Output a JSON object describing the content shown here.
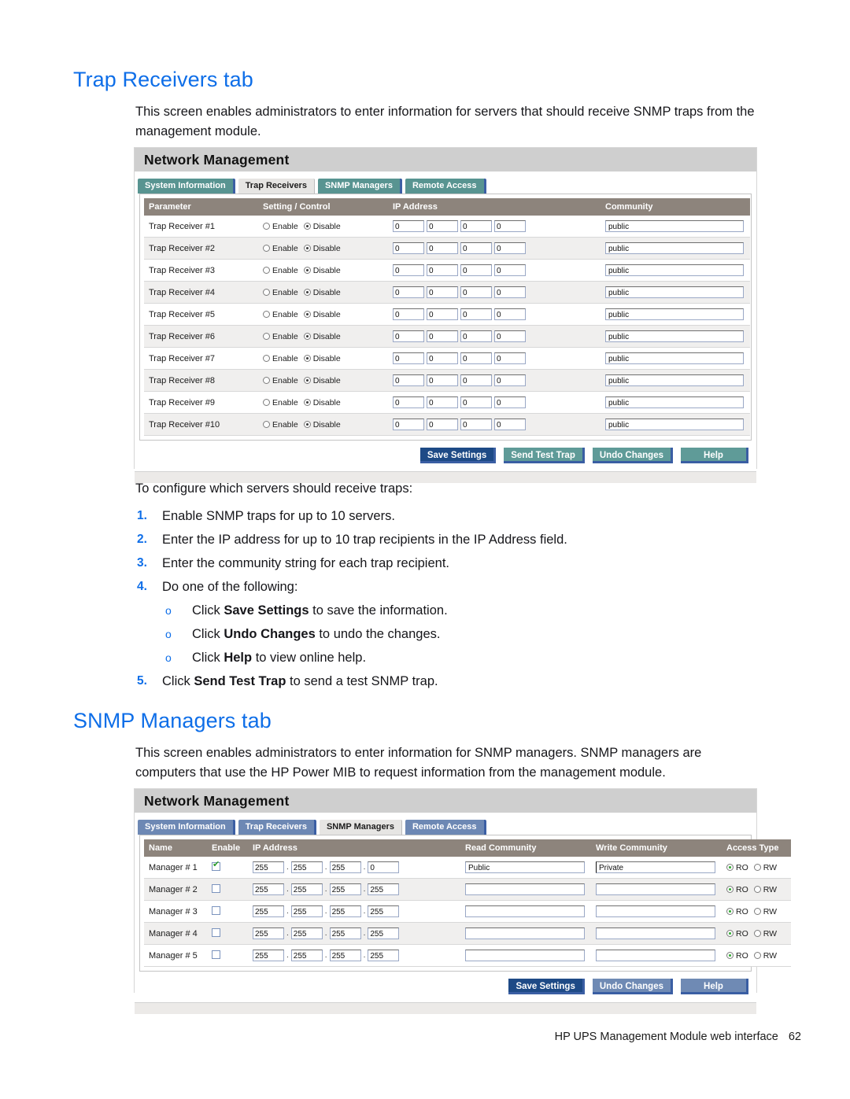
{
  "document": {
    "footer_text": "HP UPS Management Module web interface",
    "page_number": "62"
  },
  "section_trap": {
    "heading": "Trap Receivers tab",
    "intro": "This screen enables administrators to enter information for servers that should receive SNMP traps from the management module.",
    "lead_in": "To configure which servers should receive traps:",
    "steps": [
      {
        "num": "1.",
        "text": "Enable SNMP traps for up to 10 servers."
      },
      {
        "num": "2.",
        "text": "Enter the IP address for up to 10 trap recipients in the IP Address field."
      },
      {
        "num": "3.",
        "text": "Enter the community string for each trap recipient."
      },
      {
        "num": "4.",
        "text": "Do one of the following:"
      },
      {
        "num": "5.",
        "text": "Click Send Test Trap to send a test SNMP trap."
      }
    ],
    "substeps": [
      {
        "bullet": "o",
        "prefix": "Click ",
        "bold": "Save Settings",
        "suffix": " to save the information."
      },
      {
        "bullet": "o",
        "prefix": "Click ",
        "bold": "Undo Changes",
        "suffix": " to undo the changes."
      },
      {
        "bullet": "o",
        "prefix": "Click ",
        "bold": "Help",
        "suffix": " to view online help."
      }
    ],
    "step5": {
      "num": "5.",
      "prefix": "Click ",
      "bold": "Send Test Trap",
      "suffix": " to send a test SNMP trap."
    }
  },
  "section_snmp": {
    "heading": "SNMP Managers tab",
    "intro": "This screen enables administrators to enter information for SNMP managers. SNMP managers are computers that use the HP Power MIB to request information from the management module."
  },
  "shot_trap": {
    "app_title": "Network Management",
    "tabs": [
      {
        "label": "System Information",
        "active": false,
        "style": "teal"
      },
      {
        "label": "Trap Receivers",
        "active": true,
        "style": "active"
      },
      {
        "label": "SNMP Managers",
        "active": false,
        "style": "teal"
      },
      {
        "label": "Remote Access",
        "active": false,
        "style": "teal"
      }
    ],
    "columns": [
      "Parameter",
      "Setting / Control",
      "IP Address",
      "Community"
    ],
    "radio_enable_label": "Enable",
    "radio_disable_label": "Disable",
    "rows": [
      {
        "parameter": "Trap Receiver #1",
        "setting": "Disable",
        "ip": [
          "0",
          "0",
          "0",
          "0"
        ],
        "community": "public"
      },
      {
        "parameter": "Trap Receiver #2",
        "setting": "Disable",
        "ip": [
          "0",
          "0",
          "0",
          "0"
        ],
        "community": "public"
      },
      {
        "parameter": "Trap Receiver #3",
        "setting": "Disable",
        "ip": [
          "0",
          "0",
          "0",
          "0"
        ],
        "community": "public"
      },
      {
        "parameter": "Trap Receiver #4",
        "setting": "Disable",
        "ip": [
          "0",
          "0",
          "0",
          "0"
        ],
        "community": "public"
      },
      {
        "parameter": "Trap Receiver #5",
        "setting": "Disable",
        "ip": [
          "0",
          "0",
          "0",
          "0"
        ],
        "community": "public"
      },
      {
        "parameter": "Trap Receiver #6",
        "setting": "Disable",
        "ip": [
          "0",
          "0",
          "0",
          "0"
        ],
        "community": "public"
      },
      {
        "parameter": "Trap Receiver #7",
        "setting": "Disable",
        "ip": [
          "0",
          "0",
          "0",
          "0"
        ],
        "community": "public"
      },
      {
        "parameter": "Trap Receiver #8",
        "setting": "Disable",
        "ip": [
          "0",
          "0",
          "0",
          "0"
        ],
        "community": "public"
      },
      {
        "parameter": "Trap Receiver #9",
        "setting": "Disable",
        "ip": [
          "0",
          "0",
          "0",
          "0"
        ],
        "community": "public"
      },
      {
        "parameter": "Trap Receiver #10",
        "setting": "Disable",
        "ip": [
          "0",
          "0",
          "0",
          "0"
        ],
        "community": "public"
      }
    ],
    "buttons": [
      {
        "label": "Save Settings",
        "style": "navy"
      },
      {
        "label": "Send Test Trap",
        "style": "teal"
      },
      {
        "label": "Undo Changes",
        "style": "teal"
      },
      {
        "label": "Help",
        "style": "teal"
      }
    ]
  },
  "shot_snmp": {
    "app_title": "Network Management",
    "tabs": [
      {
        "label": "System Information",
        "active": false,
        "style": "blue"
      },
      {
        "label": "Trap Receivers",
        "active": false,
        "style": "blue"
      },
      {
        "label": "SNMP Managers",
        "active": true,
        "style": "active"
      },
      {
        "label": "Remote Access",
        "active": false,
        "style": "blue"
      }
    ],
    "columns": [
      "Name",
      "Enable",
      "IP Address",
      "Read Community",
      "Write Community",
      "Access Type"
    ],
    "access_ro_label": "RO",
    "access_rw_label": "RW",
    "rows": [
      {
        "name": "Manager # 1",
        "enabled": true,
        "ip": [
          "255",
          "255",
          "255",
          "0"
        ],
        "read": "Public",
        "write": "Private",
        "access": "RO"
      },
      {
        "name": "Manager # 2",
        "enabled": false,
        "ip": [
          "255",
          "255",
          "255",
          "255"
        ],
        "read": "",
        "write": "",
        "access": "RO"
      },
      {
        "name": "Manager # 3",
        "enabled": false,
        "ip": [
          "255",
          "255",
          "255",
          "255"
        ],
        "read": "",
        "write": "",
        "access": "RO"
      },
      {
        "name": "Manager # 4",
        "enabled": false,
        "ip": [
          "255",
          "255",
          "255",
          "255"
        ],
        "read": "",
        "write": "",
        "access": "RO"
      },
      {
        "name": "Manager # 5",
        "enabled": false,
        "ip": [
          "255",
          "255",
          "255",
          "255"
        ],
        "read": "",
        "write": "",
        "access": "RO"
      }
    ],
    "buttons": [
      {
        "label": "Save Settings",
        "style": "navy"
      },
      {
        "label": "Undo Changes",
        "style": "bluegray"
      },
      {
        "label": "Help",
        "style": "bluegray"
      }
    ]
  },
  "colors": {
    "heading_blue": "#0e6ee8",
    "tab_teal": "#589491",
    "tab_blue": "#6d88b4",
    "button_navy": "#1e4a86",
    "header_gray": "#8d847c"
  }
}
